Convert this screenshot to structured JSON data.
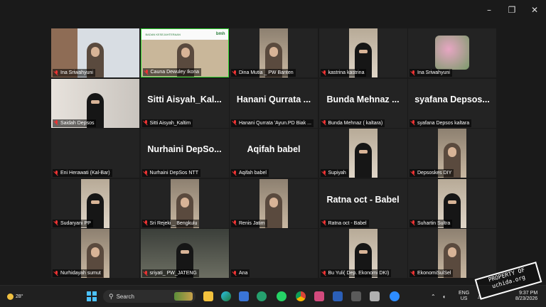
{
  "participants": [
    {
      "name": "Ina Sriwahyuni",
      "kind": "video",
      "variant": "board"
    },
    {
      "name": "Cauna Dewuley Ikona",
      "kind": "video",
      "variant": "banner",
      "active": true
    },
    {
      "name": "Dina Mutia _ PW Banten",
      "kind": "video",
      "variant": "face"
    },
    {
      "name": "kastrina kastrina",
      "kind": "video",
      "variant": "veil"
    },
    {
      "name": "Ina Sriwahyuni",
      "kind": "avatar"
    },
    {
      "name": "Saidah Depsos",
      "kind": "video",
      "variant": "veil-large"
    },
    {
      "name": "Sitti Aisyah_Kaltim",
      "kind": "name",
      "big": "Sitti Aisyah_Kal..."
    },
    {
      "name": "Hanani Qurrata 'Ayun.PD Biak ...",
      "kind": "name",
      "big": "Hanani Qurrata ..."
    },
    {
      "name": "Bunda Mehnaz ( kaltara)",
      "kind": "name",
      "big": "Bunda Mehnaz ..."
    },
    {
      "name": "syafana Depsos kaltara",
      "kind": "name",
      "big": "syafana Depsos..."
    },
    {
      "name": "Eni Herawati (Kal-Bar)",
      "kind": "blank"
    },
    {
      "name": "Nurhaini DepSos NTT",
      "kind": "name",
      "big": "Nurhaini DepSo..."
    },
    {
      "name": "Aqifah  babel",
      "kind": "name",
      "big": "Aqifah  babel"
    },
    {
      "name": "Supiyah",
      "kind": "video",
      "variant": "veil"
    },
    {
      "name": "Depsoskes DIY",
      "kind": "video",
      "variant": "face"
    },
    {
      "name": "Sudaryani PP",
      "kind": "video",
      "variant": "veil"
    },
    {
      "name": "Sri Rejeki _ Bengkulu",
      "kind": "video",
      "variant": "face"
    },
    {
      "name": "Renis Jatim",
      "kind": "video",
      "variant": "face"
    },
    {
      "name": "Ratna oct - Babel",
      "kind": "name",
      "big": "Ratna oct - Babel"
    },
    {
      "name": "Suhartin Sultra",
      "kind": "video",
      "variant": "veil"
    },
    {
      "name": "Nurhidayah sumut",
      "kind": "video",
      "variant": "face"
    },
    {
      "name": "sriyati_ PW_JATENG",
      "kind": "video",
      "variant": "dark"
    },
    {
      "name": "Ana",
      "kind": "blank"
    },
    {
      "name": "Bu Yuli( Dep. Ekonomi DKI)",
      "kind": "video",
      "variant": "veil"
    },
    {
      "name": "EkonomiSulSel",
      "kind": "video",
      "variant": "face"
    }
  ],
  "extra_tile": {
    "kind": "video",
    "variant": "face"
  },
  "banner_text": {
    "left": "BADAN KESEJAHTERAAN",
    "right": "bmh"
  },
  "taskbar": {
    "weather": "28°",
    "search_placeholder": "Search",
    "lang_top": "ENG",
    "lang_bottom": "US",
    "time": "9:37 PM",
    "date": "8/23/2026"
  },
  "watermark": {
    "line1": "PROPERTY OF",
    "line2": "uchida.org"
  },
  "colors": {
    "active_border": "#2fd62f",
    "mute": "#e33333",
    "taskbar": "#202020"
  }
}
